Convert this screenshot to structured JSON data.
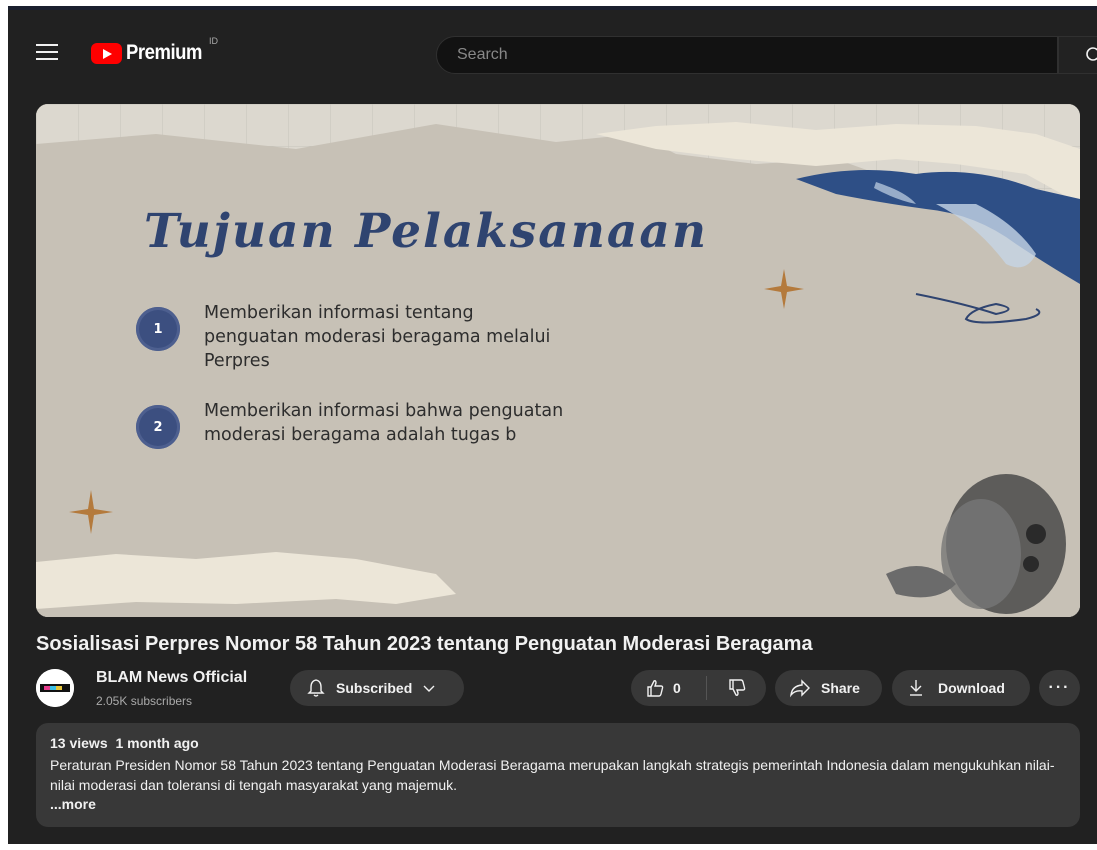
{
  "masthead": {
    "logo_text": "Premium",
    "country_code": "ID",
    "search_placeholder": "Search"
  },
  "slide": {
    "title": "Tujuan Pelaksanaan",
    "items": [
      {
        "number": "1",
        "text": "Memberikan informasi tentang penguatan moderasi beragama melalui Perpres"
      },
      {
        "number": "2",
        "text": "Memberikan informasi bahwa penguatan moderasi beragama adalah tugas b"
      }
    ]
  },
  "video": {
    "title": "Sosialisasi Perpres Nomor 58 Tahun 2023 tentang Penguatan Moderasi Beragama"
  },
  "channel": {
    "name": "BLAM News Official",
    "subscribers": "2.05K subscribers"
  },
  "actions": {
    "subscribed_label": "Subscribed",
    "like_count": "0",
    "share_label": "Share",
    "download_label": "Download",
    "more_label": "···"
  },
  "description": {
    "views": "13 views",
    "date": "1 month ago",
    "text": "Peraturan Presiden Nomor 58 Tahun 2023 tentang Penguatan Moderasi Beragama merupakan langkah strategis pemerintah Indonesia dalam mengukuhkan nilai-nilai moderasi dan toleransi di tengah masyarakat yang majemuk.",
    "more_link": "...more"
  },
  "colors": {
    "background": "#212121",
    "pill": "#383838",
    "brand_red": "#ff0000",
    "slide_title": "#2f4470"
  }
}
